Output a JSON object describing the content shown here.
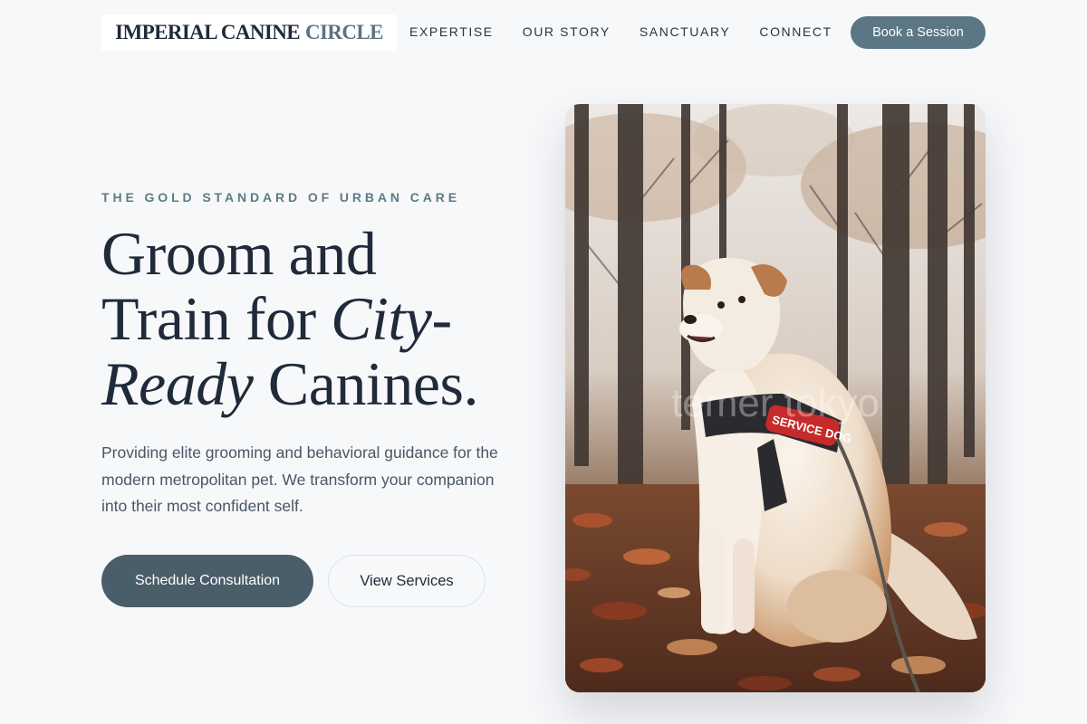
{
  "header": {
    "logo_primary": "IMPERIAL CANINE",
    "logo_accent": "CIRCLE",
    "nav": [
      {
        "label": "EXPERTISE"
      },
      {
        "label": "OUR STORY"
      },
      {
        "label": "SANCTUARY"
      },
      {
        "label": "CONNECT"
      }
    ],
    "cta_label": "Book a Session"
  },
  "hero": {
    "eyebrow": "THE GOLD STANDARD OF URBAN CARE",
    "headline": {
      "line1": "Groom and",
      "line2_pre": "Train for ",
      "line2_em": "City",
      "line2_post": "-",
      "line3_em": "Ready",
      "line3_post": " Canines."
    },
    "subtext": "Providing elite grooming and behavioral guidance for the modern metropolitan pet. We transform your companion into their most confident self.",
    "primary_button": "Schedule Consultation",
    "secondary_button": "View Services",
    "image": {
      "harness_label": "SERVICE DOG",
      "watermark": "temer tokyo"
    }
  },
  "colors": {
    "background": "#f7f8fa",
    "navy": "#1f2a3a",
    "accent_slate": "#5b7684",
    "primary_button": "#4a5e69",
    "eyebrow": "#5e7a88"
  }
}
